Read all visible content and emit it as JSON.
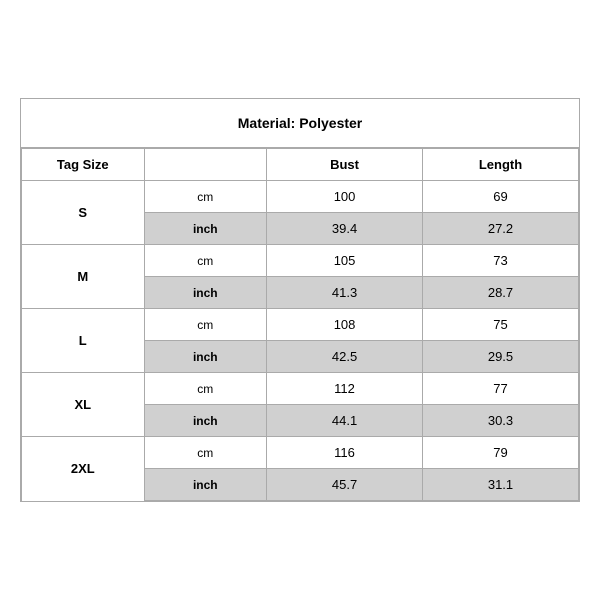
{
  "title": "Material: Polyester",
  "headers": {
    "tag_size": "Tag Size",
    "bust": "Bust",
    "length": "Length"
  },
  "rows": [
    {
      "size": "S",
      "cm": {
        "bust": "100",
        "length": "69"
      },
      "inch": {
        "bust": "39.4",
        "length": "27.2"
      }
    },
    {
      "size": "M",
      "cm": {
        "bust": "105",
        "length": "73"
      },
      "inch": {
        "bust": "41.3",
        "length": "28.7"
      }
    },
    {
      "size": "L",
      "cm": {
        "bust": "108",
        "length": "75"
      },
      "inch": {
        "bust": "42.5",
        "length": "29.5"
      }
    },
    {
      "size": "XL",
      "cm": {
        "bust": "112",
        "length": "77"
      },
      "inch": {
        "bust": "44.1",
        "length": "30.3"
      }
    },
    {
      "size": "2XL",
      "cm": {
        "bust": "116",
        "length": "79"
      },
      "inch": {
        "bust": "45.7",
        "length": "31.1"
      }
    }
  ]
}
